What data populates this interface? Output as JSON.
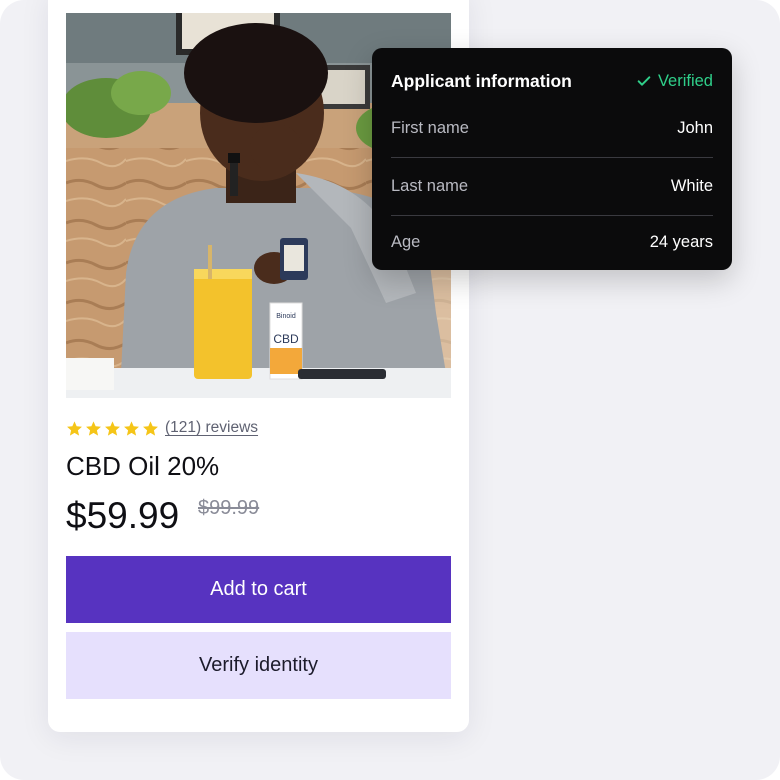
{
  "product": {
    "rating": 5,
    "reviews_label": "(121) reviews",
    "name": "CBD Oil 20%",
    "price": "$59.99",
    "original_price": "$99.99",
    "add_to_cart_label": "Add to cart",
    "verify_identity_label": "Verify identity",
    "image": {
      "bottle_brand": "Binoid",
      "bottle_label": "CBD"
    }
  },
  "applicant": {
    "title": "Applicant information",
    "status_label": "Verified",
    "status_icon": "check-icon",
    "fields": [
      {
        "label": "First name",
        "value": "John"
      },
      {
        "label": "Last name",
        "value": "White"
      },
      {
        "label": "Age",
        "value": "24 years"
      }
    ]
  },
  "colors": {
    "primary": "#5733c0",
    "secondary_button": "#e6e0fd",
    "verified": "#2fcf8a",
    "star": "#f5c518",
    "panel_bg": "#0b0b0c"
  }
}
